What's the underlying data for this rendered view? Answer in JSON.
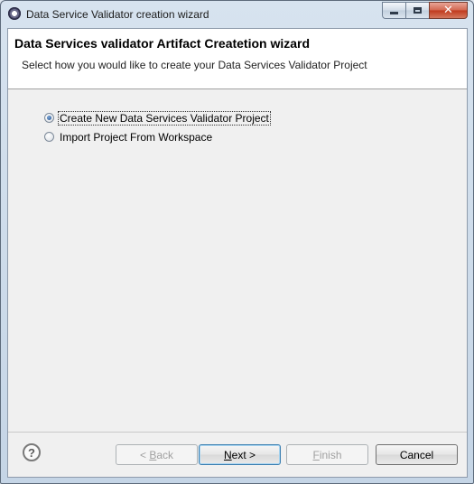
{
  "window": {
    "title": "Data Service Validator creation wizard",
    "icon": "eclipse-icon",
    "controls": [
      "minimize-icon",
      "maximize-icon",
      "close-icon"
    ]
  },
  "header": {
    "title": "Data Services validator Artifact Createtion wizard",
    "description": "Select how you would like to create your Data Services Validator Project"
  },
  "options": [
    {
      "label": "Create New Data Services Validator Project",
      "selected": true
    },
    {
      "label": "Import Project From Workspace",
      "selected": false
    }
  ],
  "footer": {
    "help_icon": "help-icon",
    "back_prefix": "< ",
    "back_mnemonic": "B",
    "back_rest": "ack",
    "next_mnemonic": "N",
    "next_rest": "ext >",
    "finish_mnemonic": "F",
    "finish_rest": "inish",
    "cancel_label": "Cancel"
  }
}
